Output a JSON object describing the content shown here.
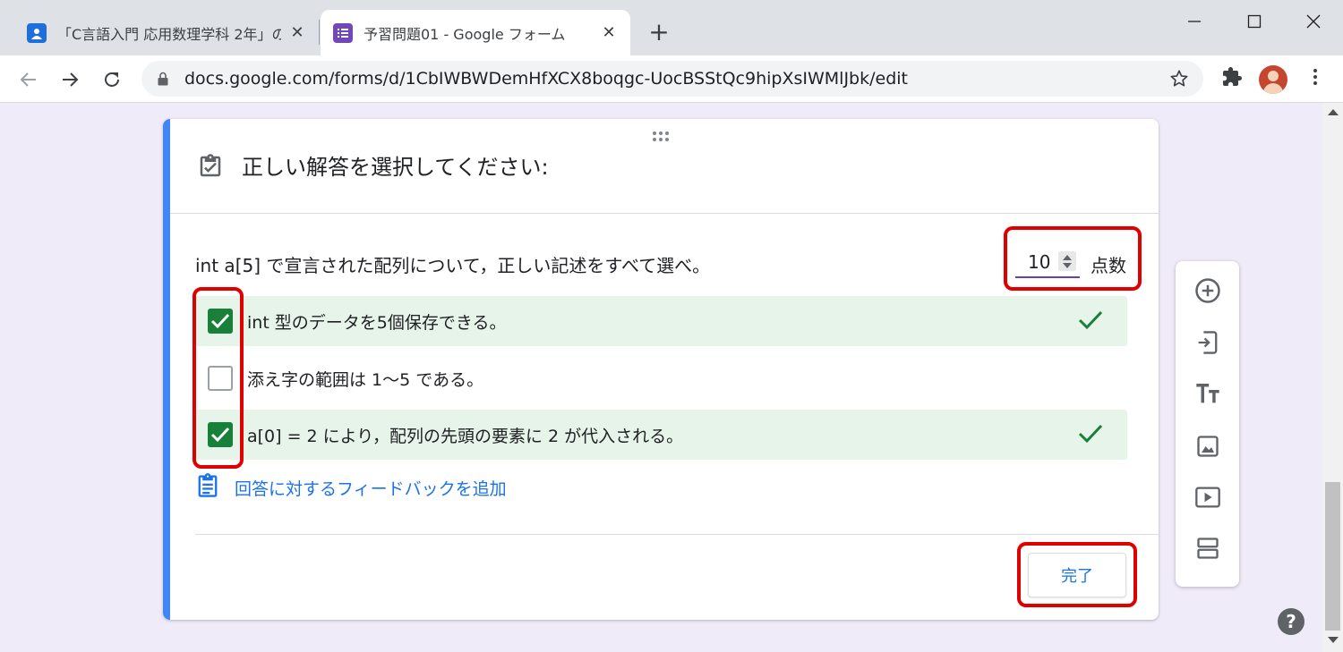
{
  "browser": {
    "tabs": [
      {
        "title": "「C言語入門 応用数理学科 2年」の",
        "icon": "google-classroom-icon",
        "active": false
      },
      {
        "title": "予習問題01 - Google フォーム",
        "icon": "google-forms-icon",
        "active": true
      }
    ],
    "new_tab_label": "+",
    "url": "docs.google.com/forms/d/1CbIWBWDemHfXCX8boqgc-UocBSStQc9hipXsIWMlJbk/edit"
  },
  "form": {
    "header_title": "正しい解答を選択してください:",
    "question_text": "int a[5] で宣言された配列について，正しい記述をすべて選べ。",
    "points_value": "10",
    "points_label": "点数",
    "options": [
      {
        "text": "int 型のデータを5個保存できる。",
        "checked": true,
        "correct": true
      },
      {
        "text": "添え字の範囲は 1～5 である。",
        "checked": false,
        "correct": false
      },
      {
        "text": "a[0] = 2 により，配列の先頭の要素に 2 が代入される。",
        "checked": true,
        "correct": true
      }
    ],
    "feedback_link": "回答に対するフィードバックを追加",
    "done_button": "完了"
  },
  "side_toolbar": [
    "add-question-icon",
    "import-questions-icon",
    "add-title-icon",
    "add-image-icon",
    "add-video-icon",
    "add-section-icon"
  ],
  "help_label": "?",
  "colors": {
    "accent_blue": "#4285f4",
    "forms_purple": "#673ab7",
    "correct_green": "#188038",
    "correct_bg": "#e6f4ea",
    "annotation_red": "#e00000",
    "page_bg": "#f0ebf8"
  }
}
